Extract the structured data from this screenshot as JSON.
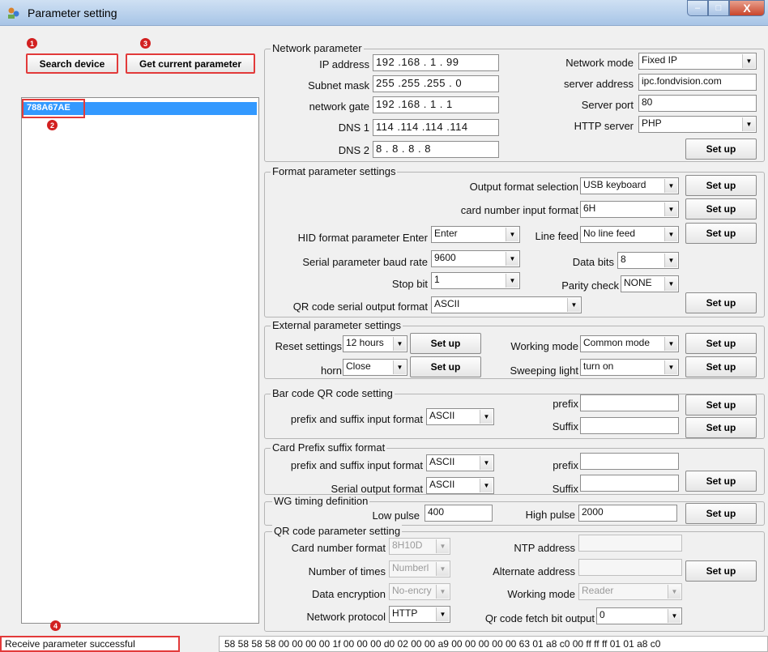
{
  "window": {
    "title": "Parameter setting",
    "controls": {
      "minimize": "–",
      "maximize": "□",
      "close": "X"
    }
  },
  "markers": [
    "1",
    "2",
    "3",
    "4"
  ],
  "left_panel": {
    "search_button": "Search device",
    "get_param_button": "Get current parameter",
    "devices": [
      "788A67AE"
    ]
  },
  "network": {
    "legend": "Network parameter",
    "ip_label": "IP address",
    "ip_value": "192 .168 . 1 . 99",
    "subnet_label": "Subnet mask",
    "subnet_value": "255 .255 .255 . 0",
    "gate_label": "network gate",
    "gate_value": "192 .168 . 1 . 1",
    "dns1_label": "DNS 1",
    "dns1_value": "114 .114 .114 .114",
    "dns2_label": "DNS 2",
    "dns2_value": " 8 . 8 . 8 . 8",
    "mode_label": "Network mode",
    "mode_value": "Fixed IP",
    "server_label": "server address",
    "server_value": "ipc.fondvision.com",
    "port_label": "Server port",
    "port_value": "80",
    "http_label": "HTTP server",
    "http_value": "PHP",
    "setup": "Set up"
  },
  "format": {
    "legend": "Format parameter settings",
    "output_label": "Output format selection",
    "output_value": "USB keyboard",
    "card_input_label": "card number input format",
    "card_input_value": "6H",
    "hid_label": "HID format parameter  Enter",
    "hid_value": "Enter",
    "linefeed_label": "Line feed",
    "linefeed_value": "No line feed",
    "baud_label": "Serial parameter baud rate",
    "baud_value": "9600",
    "databits_label": "Data bits",
    "databits_value": "8",
    "stopbit_label": "Stop bit",
    "stopbit_value": "1",
    "parity_label": "Parity check",
    "parity_value": "NONE",
    "qr_serial_label": "QR code serial output format",
    "qr_serial_value": "ASCII",
    "setup": "Set up"
  },
  "external": {
    "legend": "External parameter settings",
    "reset_label": "Reset settings",
    "reset_value": "12 hours",
    "horn_label": "horn",
    "horn_value": "Close",
    "working_label": "Working mode",
    "working_value": "Common mode",
    "sweep_label": "Sweeping light",
    "sweep_value": "turn on",
    "setup": "Set up"
  },
  "barcode": {
    "legend": "Bar code QR code setting",
    "ps_label": "prefix and suffix input format",
    "ps_value": "ASCII",
    "prefix_label": "prefix",
    "prefix_value": "",
    "suffix_label": "Suffix",
    "suffix_value": "",
    "setup": "Set up"
  },
  "card_prefix": {
    "legend": "Card Prefix suffix format",
    "ps_label": "prefix and suffix input format",
    "ps_value": "ASCII",
    "serial_label": "Serial output format",
    "serial_value": "ASCII",
    "prefix_label": "prefix",
    "prefix_value": "",
    "suffix_label": "Suffix",
    "suffix_value": "",
    "setup": "Set up"
  },
  "wg": {
    "legend": "WG timing definition",
    "low_label": "Low pulse",
    "low_value": "400",
    "high_label": "High pulse",
    "high_value": "2000",
    "setup": "Set up"
  },
  "qr": {
    "legend": "QR code parameter setting",
    "card_label": "Card number format",
    "card_value": "8H10D",
    "times_label": "Number of times",
    "times_value": "Numberl",
    "enc_label": "Data encryption",
    "enc_value": "No-encry",
    "proto_label": "Network protocol",
    "proto_value": "HTTP",
    "ntp_label": "NTP address",
    "ntp_value": "",
    "alt_label": "Alternate address",
    "alt_value": "",
    "wmode_label": "Working mode",
    "wmode_value": "Reader",
    "fetch_label": "Qr code fetch bit output",
    "fetch_value": "0",
    "setup": "Set up"
  },
  "status": {
    "left": "Receive parameter successful",
    "right": "58 58 58 58 00 00 00 00 1f 00 00 00 d0 02 00 00 a9 00 00 00 00 00 63 01 a8 c0 00 ff ff ff 01 01 a8 c0"
  }
}
